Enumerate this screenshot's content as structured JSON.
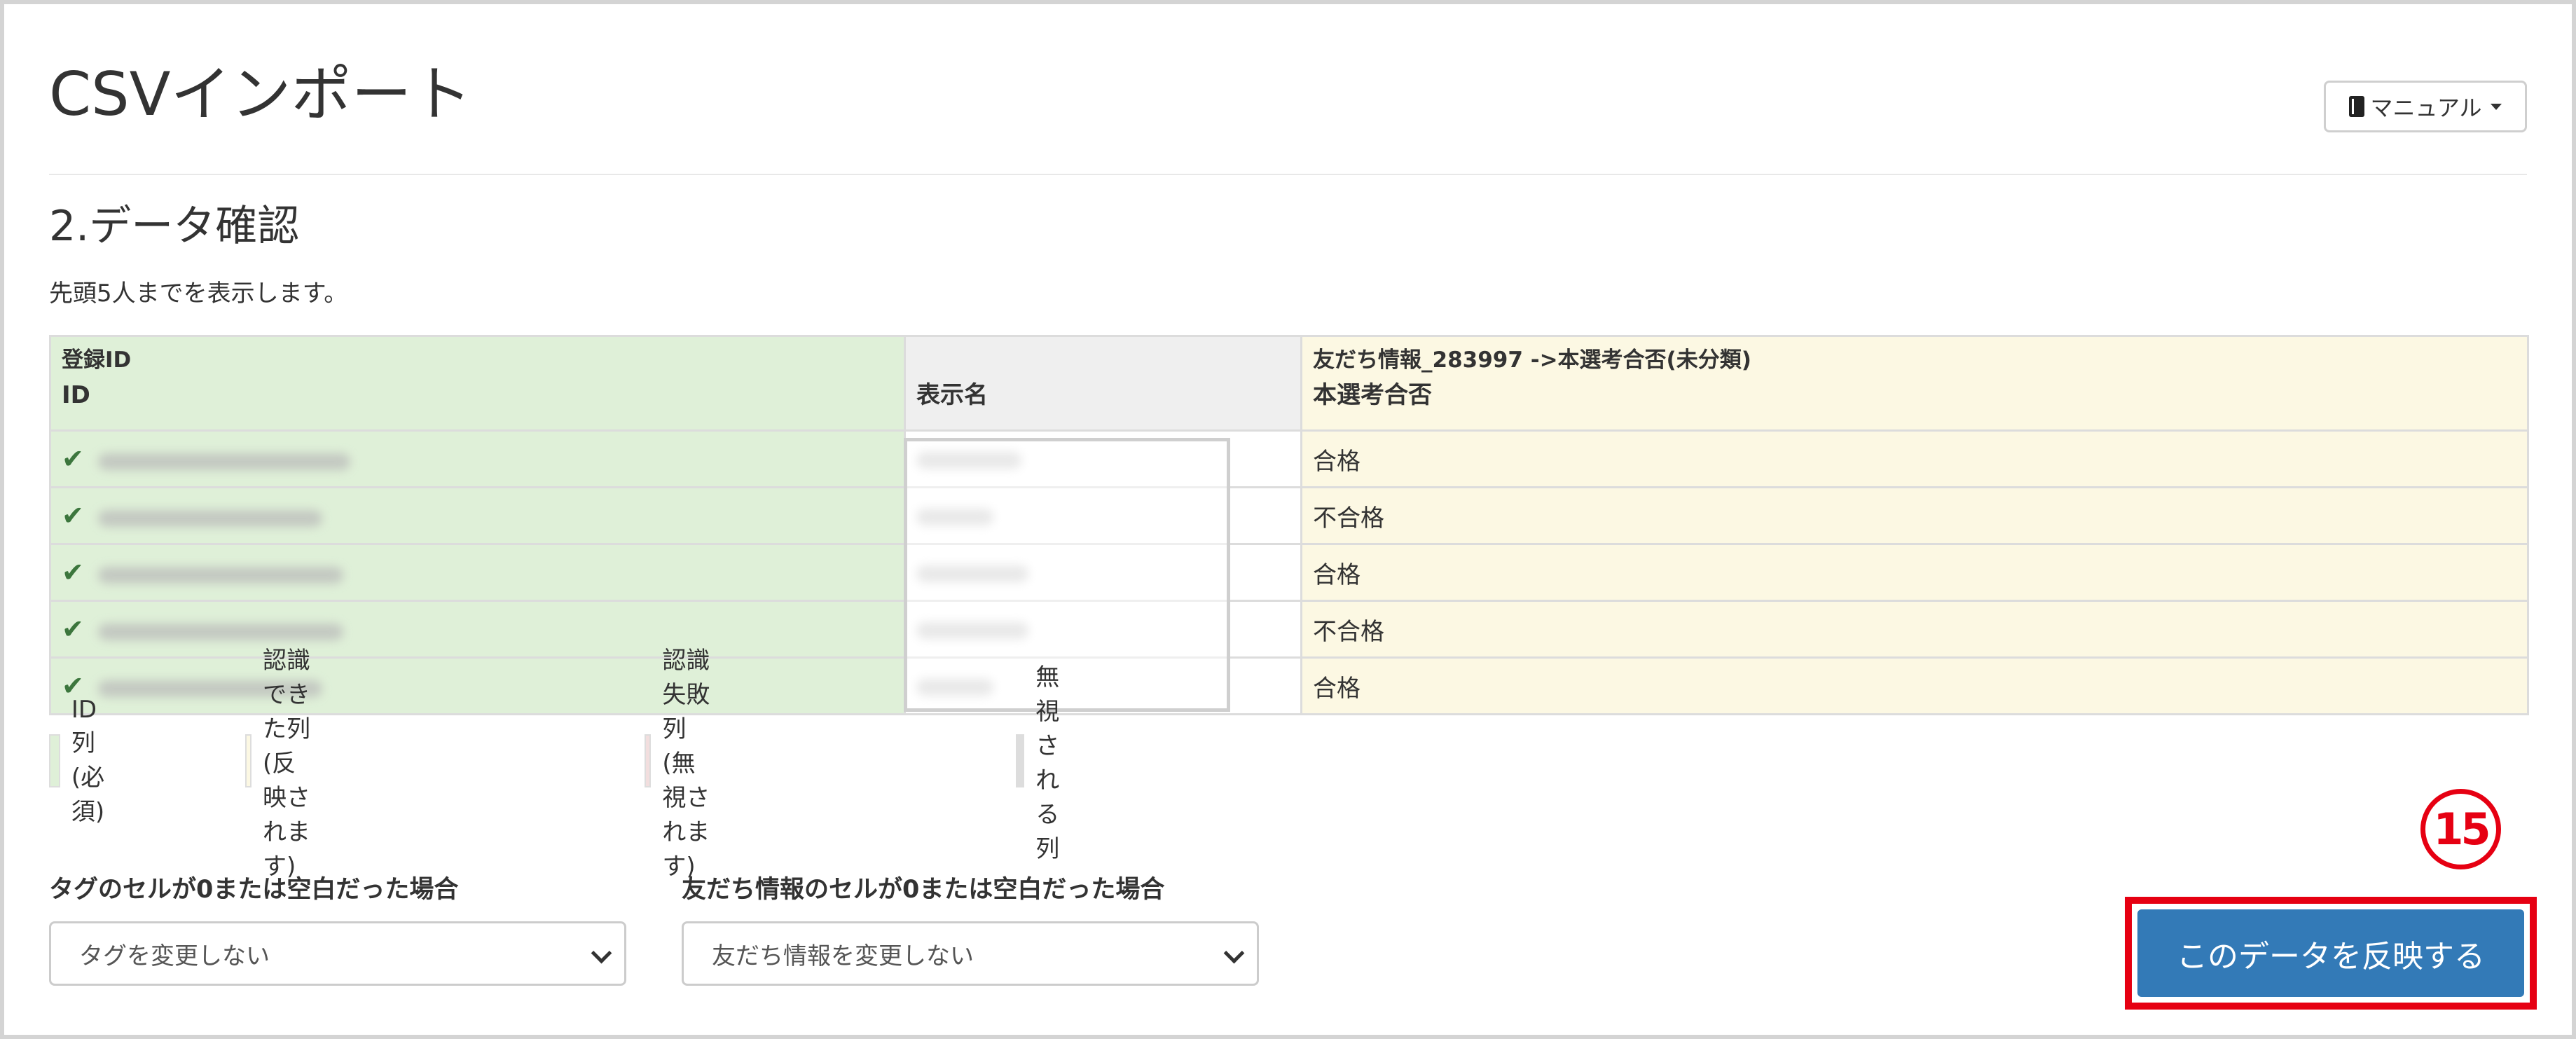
{
  "header": {
    "title": "CSVインポート",
    "manual_label": "マニュアル",
    "manual_icon": "book-icon"
  },
  "section": {
    "title": "2.データ確認",
    "note": "先頭5人までを表示します。"
  },
  "table": {
    "columns": [
      {
        "mapping": "登録ID",
        "label": "ID"
      },
      {
        "mapping": "",
        "label": "表示名"
      },
      {
        "mapping": "友だち情報_283997 ->本選考合否(未分類)",
        "label": "本選考合否"
      }
    ],
    "rows": [
      {
        "status": "✔",
        "result": "合格"
      },
      {
        "status": "✔",
        "result": "不合格"
      },
      {
        "status": "✔",
        "result": "合格"
      },
      {
        "status": "✔",
        "result": "不合格"
      },
      {
        "status": "✔",
        "result": "合格"
      }
    ]
  },
  "legend": [
    {
      "label": "ID列(必須)",
      "color": "#dff0d8"
    },
    {
      "label": "認識できた列(反映されます)",
      "color": "#fcf8e3"
    },
    {
      "label": "認識失敗列(無視されます)",
      "color": "#f2dede"
    },
    {
      "label": "無視される列",
      "color": "#dddddd"
    }
  ],
  "options": {
    "tag_label": "タグのセルが0または空白だった場合",
    "tag_value": "タグを変更しない",
    "friend_label": "友だち情報のセルが0または空白だった場合",
    "friend_value": "友だち情報を変更しない"
  },
  "annotation": {
    "step": "15",
    "color": "#e60012"
  },
  "actions": {
    "apply_label": "このデータを反映する",
    "apply_color": "#337ab7"
  }
}
